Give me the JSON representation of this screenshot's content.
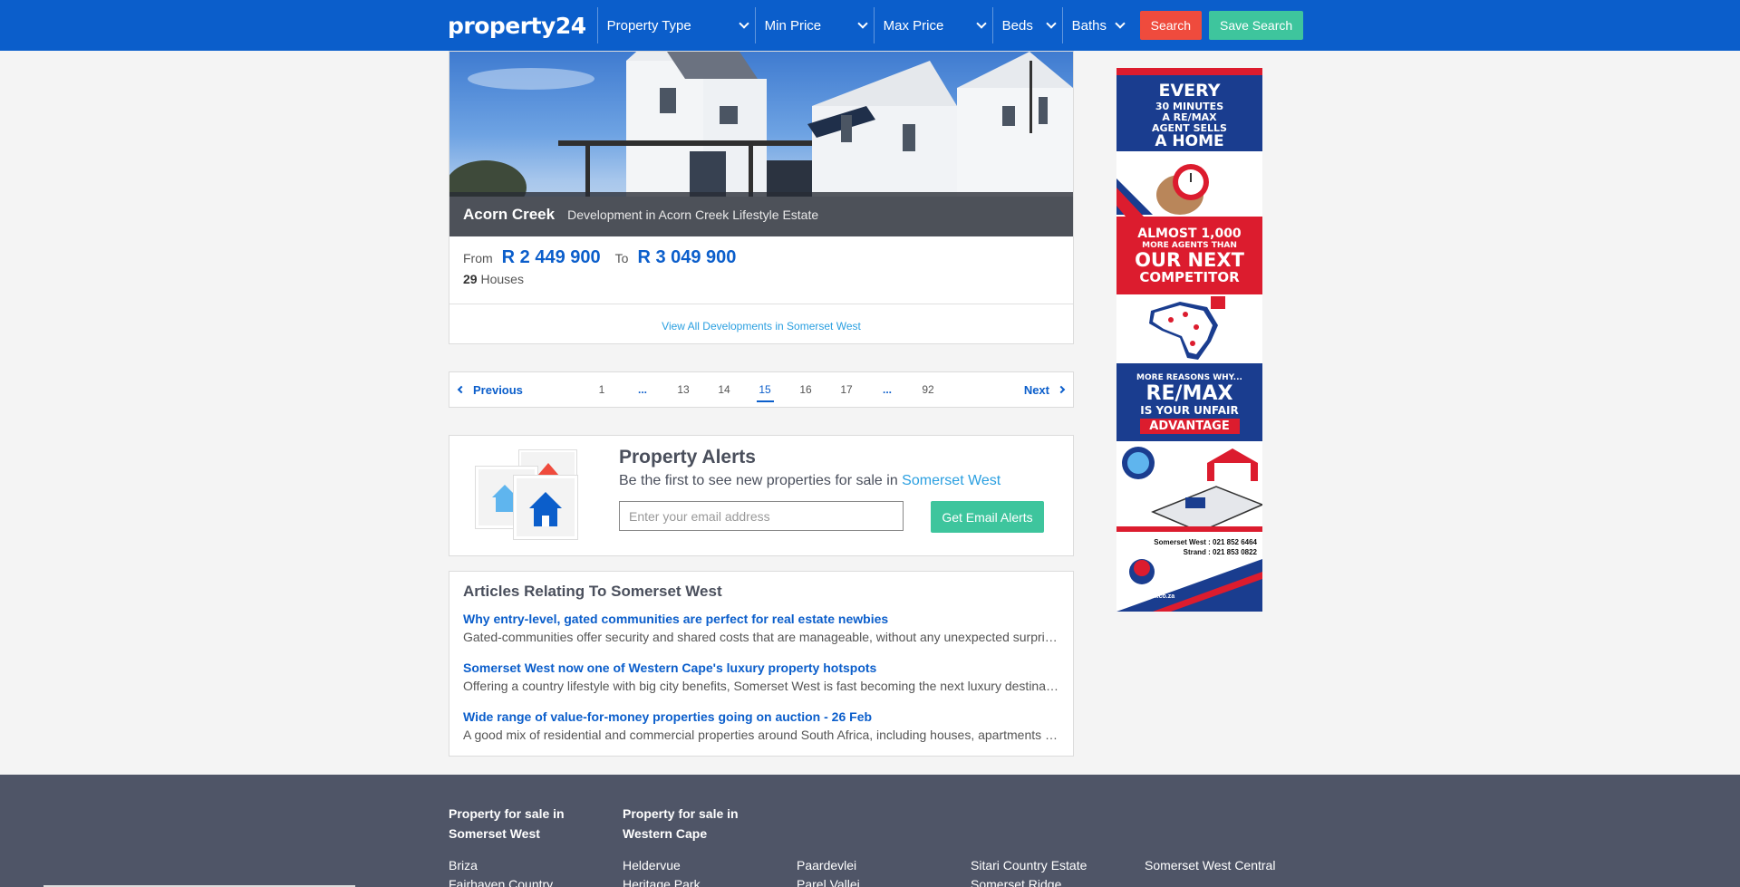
{
  "header": {
    "logo": "property24",
    "filters": [
      {
        "label": "Property Type"
      },
      {
        "label": "Min Price"
      },
      {
        "label": "Max Price"
      },
      {
        "label": "Beds"
      },
      {
        "label": "Baths"
      }
    ],
    "search_label": "Search",
    "save_search_label": "Save Search"
  },
  "development": {
    "name": "Acorn Creek",
    "subtitle": "Development in Acorn Creek Lifestyle Estate",
    "from_label": "From",
    "price_from": "R 2 449 900",
    "to_label": "To",
    "price_to": "R 3 049 900",
    "unit_count": "29",
    "unit_type": "Houses",
    "view_all": "View All Developments in Somerset West"
  },
  "pagination": {
    "previous": "Previous",
    "next": "Next",
    "pages": [
      "1",
      "...",
      "13",
      "14",
      "15",
      "16",
      "17",
      "...",
      "92"
    ],
    "current": "15"
  },
  "alerts": {
    "title": "Property Alerts",
    "description": "Be the first to see new properties for sale in",
    "location": "Somerset West",
    "email_placeholder": "Enter your email address",
    "button": "Get Email Alerts"
  },
  "articles": {
    "heading": "Articles Relating To Somerset West",
    "items": [
      {
        "title": "Why entry-level, gated communities are perfect for real estate newbies",
        "text": "Gated-communities offer security and shared costs that are manageable, without any unexpected surprises..."
      },
      {
        "title": "Somerset West now one of Western Cape's luxury property hotspots",
        "text": "Offering a country lifestyle with big city benefits, Somerset West is fast becoming the next luxury destination..."
      },
      {
        "title": "Wide range of value-for-money properties going on auction - 26 Feb",
        "text": "A good mix of residential and commercial properties around South Africa, including houses, apartments and more..."
      }
    ]
  },
  "ad": {
    "line1": "EVERY",
    "line2": "30 MINUTES",
    "line3": "A RE/MAX",
    "line4": "AGENT SELLS",
    "line5": "A HOME",
    "line6": "ALMOST 1,000",
    "line7": "MORE AGENTS THAN",
    "line8": "OUR NEXT",
    "line9": "COMPETITOR",
    "line10": "MORE REASONS WHY...",
    "line11": "RE/MAX",
    "line12": "IS YOUR UNFAIR",
    "line13": "ADVANTAGE",
    "contact1": "Somerset West : 021 852 6464",
    "contact2": "Strand : 021 853 0822",
    "website": "www.remax.co.za",
    "brand_red": "#dc1c2e",
    "brand_blue": "#1a3d8f"
  },
  "footer": {
    "col1_heading": "Property for sale in Somerset West",
    "col2_heading": "Property for sale in Western Cape",
    "links": [
      "Briza",
      "Heldervue",
      "Paardevlei",
      "Sitari Country Estate",
      "Somerset West Central"
    ],
    "links_row2": [
      "Fairhaven Country",
      "Heritage Park",
      "Parel Vallei",
      "Somerset Ridge"
    ]
  },
  "colors": {
    "brand_blue": "#0b5ecb",
    "search_red": "#ef4b3d",
    "save_green": "#3ec59d",
    "link_light_blue": "#2a9fe0",
    "footer_bg": "#4f5567"
  }
}
